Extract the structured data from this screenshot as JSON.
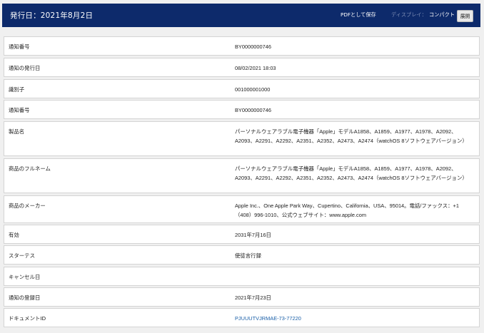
{
  "header": {
    "title": "発行日：2021年8月2日",
    "pdf_label": "PDFとして保存",
    "display_label": "ディスプレイ：",
    "compact_label": "コンパクト",
    "expand_label": "展開"
  },
  "rows": [
    {
      "label": "通知番号",
      "value": "BY0000000746"
    },
    {
      "label": "通知の発行日",
      "value": "08/02/2021 18:03"
    },
    {
      "label": "識別子",
      "value": "001000001000"
    },
    {
      "label": "通知番号",
      "value": "BY0000000746"
    },
    {
      "label": "製品名",
      "value": "パーソナルウェアラブル電子機器「Apple」モデルA1858、A1859、A1977、A1978、A2092、A2093、A2291、A2292、A2351、A2352、A2473、A2474（watchOS 8ソフトウェアバージョン）"
    },
    {
      "label": "商品のフルネーム",
      "value": "パーソナルウェアラブル電子機器「Apple」モデルA1858、A1859、A1977、A1978、A2092、A2093、A2291、A2292、A2351、A2352、A2473、A2474（watchOS 8ソフトウェアバージョン）"
    },
    {
      "label": "商品のメーカー",
      "value": "Apple Inc.、One Apple Park Way、Cupertino、California、USA、95014。電話/ファックス：+1（408）996-1010、公式ウェブサイト：www.apple.com"
    },
    {
      "label": "有効",
      "value": "2031年7月16日"
    },
    {
      "label": "スターテス",
      "value": "使徒言行録"
    },
    {
      "label": "キャンセル日",
      "value": ""
    },
    {
      "label": "通知の登録日",
      "value": "2021年7月23日"
    },
    {
      "label": "ドキュメントID",
      "value": "PJUUUTVJRMAE-73-77220"
    }
  ]
}
